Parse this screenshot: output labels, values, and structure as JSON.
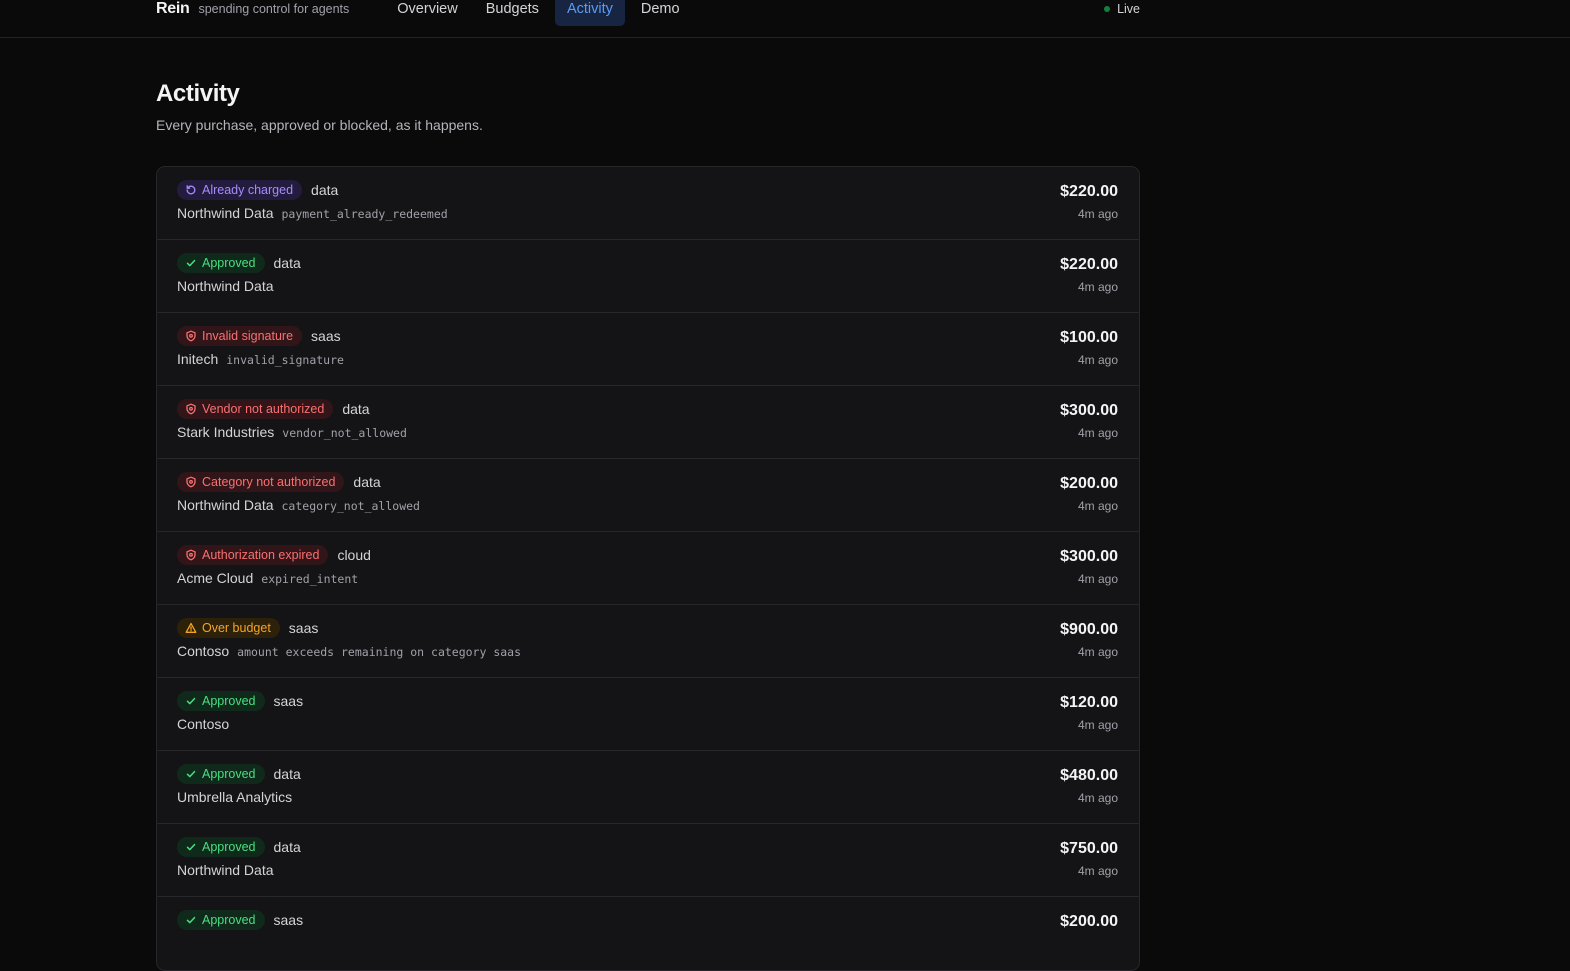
{
  "header": {
    "brand": "Rein",
    "tagline": "spending control for agents",
    "nav": [
      "Overview",
      "Budgets",
      "Activity",
      "Demo"
    ],
    "active_nav": "Activity",
    "status": "Live"
  },
  "page": {
    "title": "Activity",
    "subtitle": "Every purchase, approved or blocked, as it happens."
  },
  "colors": {
    "approved": "#4ade80",
    "blocked": "#f87171",
    "warning": "#f5a524",
    "already": "#a78bfa",
    "active_nav": "#5b9bf5"
  },
  "rows": [
    {
      "status": "Already charged",
      "kind": "already",
      "icon": "refresh-icon",
      "category": "data",
      "vendor": "Northwind Data",
      "code": "payment_already_redeemed",
      "amount": "$220.00",
      "time": "4m ago"
    },
    {
      "status": "Approved",
      "kind": "approved",
      "icon": "check-icon",
      "category": "data",
      "vendor": "Northwind Data",
      "code": "",
      "amount": "$220.00",
      "time": "4m ago"
    },
    {
      "status": "Invalid signature",
      "kind": "blocked",
      "icon": "shield-icon",
      "category": "saas",
      "vendor": "Initech",
      "code": "invalid_signature",
      "amount": "$100.00",
      "time": "4m ago"
    },
    {
      "status": "Vendor not authorized",
      "kind": "blocked",
      "icon": "shield-icon",
      "category": "data",
      "vendor": "Stark Industries",
      "code": "vendor_not_allowed",
      "amount": "$300.00",
      "time": "4m ago"
    },
    {
      "status": "Category not authorized",
      "kind": "blocked",
      "icon": "shield-icon",
      "category": "data",
      "vendor": "Northwind Data",
      "code": "category_not_allowed",
      "amount": "$200.00",
      "time": "4m ago"
    },
    {
      "status": "Authorization expired",
      "kind": "blocked",
      "icon": "shield-icon",
      "category": "cloud",
      "vendor": "Acme Cloud",
      "code": "expired_intent",
      "amount": "$300.00",
      "time": "4m ago"
    },
    {
      "status": "Over budget",
      "kind": "warning",
      "icon": "warning-icon",
      "category": "saas",
      "vendor": "Contoso",
      "code": "amount exceeds remaining on category saas",
      "amount": "$900.00",
      "time": "4m ago"
    },
    {
      "status": "Approved",
      "kind": "approved",
      "icon": "check-icon",
      "category": "saas",
      "vendor": "Contoso",
      "code": "",
      "amount": "$120.00",
      "time": "4m ago"
    },
    {
      "status": "Approved",
      "kind": "approved",
      "icon": "check-icon",
      "category": "data",
      "vendor": "Umbrella Analytics",
      "code": "",
      "amount": "$480.00",
      "time": "4m ago"
    },
    {
      "status": "Approved",
      "kind": "approved",
      "icon": "check-icon",
      "category": "data",
      "vendor": "Northwind Data",
      "code": "",
      "amount": "$750.00",
      "time": "4m ago"
    },
    {
      "status": "Approved",
      "kind": "approved",
      "icon": "check-icon",
      "category": "saas",
      "vendor": "",
      "code": "",
      "amount": "$200.00",
      "time": ""
    }
  ]
}
